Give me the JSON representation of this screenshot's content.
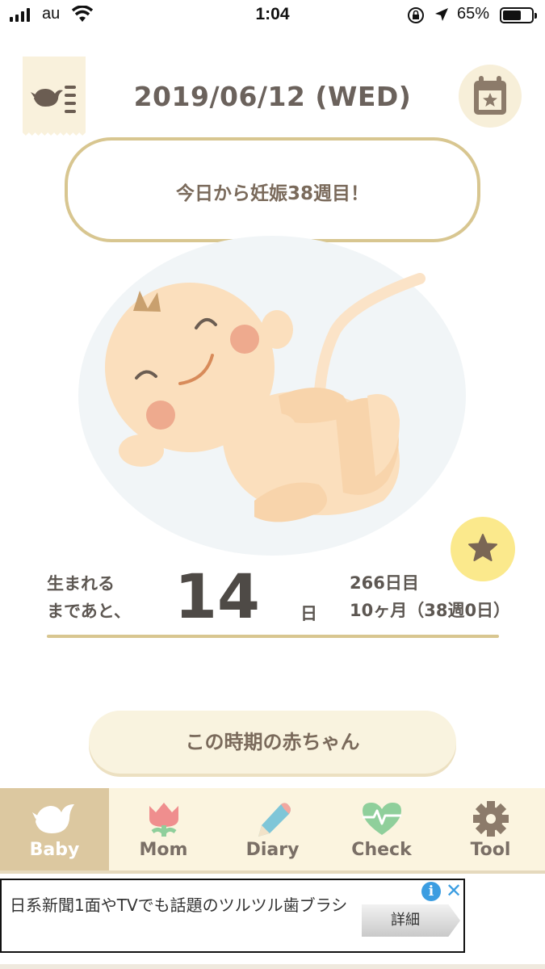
{
  "status_bar": {
    "carrier": "au",
    "time": "1:04",
    "battery": "65%",
    "battery_level": 0.65,
    "icons": [
      "signal-icon",
      "wifi-icon",
      "rotation-lock-icon",
      "location-icon",
      "battery-icon"
    ]
  },
  "header": {
    "date": "2019/06/12 (WED)",
    "menu_icon": "bird-menu-icon",
    "calendar_icon": "calendar-star-icon"
  },
  "bubble": {
    "text": "今日から妊娠38週目！"
  },
  "countdown": {
    "label": "生まれる\nまであと、",
    "days": "14",
    "unit": "日",
    "day_count": "266日目",
    "month_week": "10ヶ月（38週0日）"
  },
  "favorite_icon": "star-icon",
  "period_button": {
    "label": "この時期の赤ちゃん"
  },
  "tabs": [
    {
      "label": "Baby",
      "icon": "bird-icon",
      "active": true
    },
    {
      "label": "Mom",
      "icon": "tulip-icon",
      "active": false
    },
    {
      "label": "Diary",
      "icon": "pencil-icon",
      "active": false
    },
    {
      "label": "Check",
      "icon": "heartbeat-icon",
      "active": false
    },
    {
      "label": "Tool",
      "icon": "gear-icon",
      "active": false
    }
  ],
  "ad": {
    "text": "日系新聞1面やTVでも話題のツルツル歯ブラシ",
    "button": "詳細",
    "info_icon": "info-icon",
    "close_icon": "close-icon"
  },
  "colors": {
    "accent_gold": "#d8c690",
    "cream": "#f9f1dc",
    "active_tab": "#dcc8a0",
    "text_brown": "#7a6a5b",
    "star_yellow": "#fbe98c",
    "tulip_pink": "#ef8e8e",
    "pencil_blue": "#7fc6d8",
    "heart_green": "#8fcf9b",
    "gear_brown": "#8c7b6a"
  }
}
